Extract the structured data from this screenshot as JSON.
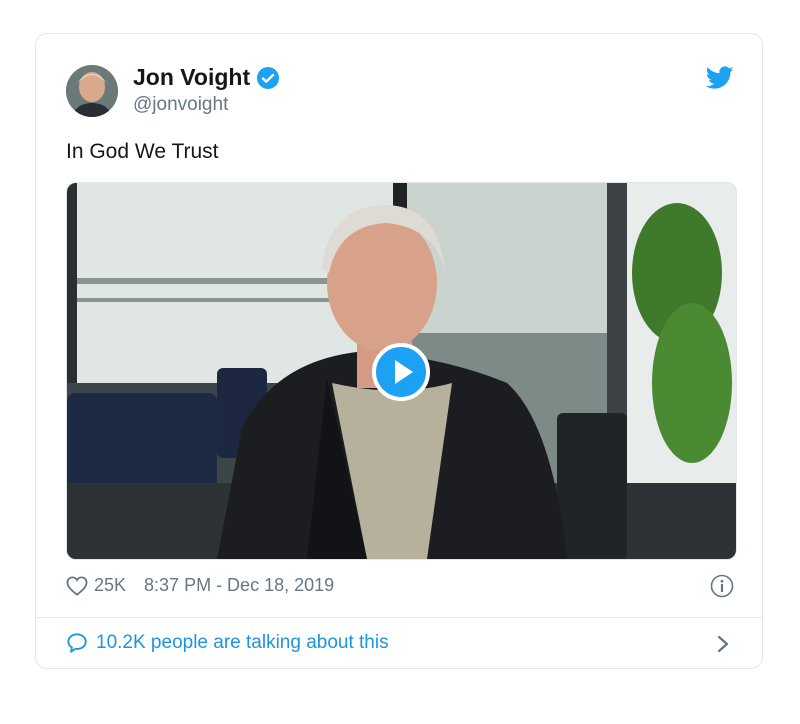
{
  "tweet": {
    "author": {
      "display_name": "Jon Voight",
      "handle": "@jonvoight",
      "verified": true
    },
    "text": "In God We Trust",
    "media": {
      "type": "video",
      "icon": "play-icon"
    },
    "likes": "25K",
    "timestamp": "8:37 PM - Dec 18, 2019",
    "conversation": "10.2K people are talking about this"
  },
  "icons": {
    "brand": "twitter-bird-icon",
    "verified": "verified-badge-icon",
    "like": "heart-icon",
    "info": "info-icon",
    "reply": "speech-bubble-icon",
    "more": "chevron-right-icon"
  },
  "colors": {
    "accent": "#1da1f2",
    "link": "#1b95e0",
    "muted": "#657786",
    "border": "#e1e8ed"
  }
}
